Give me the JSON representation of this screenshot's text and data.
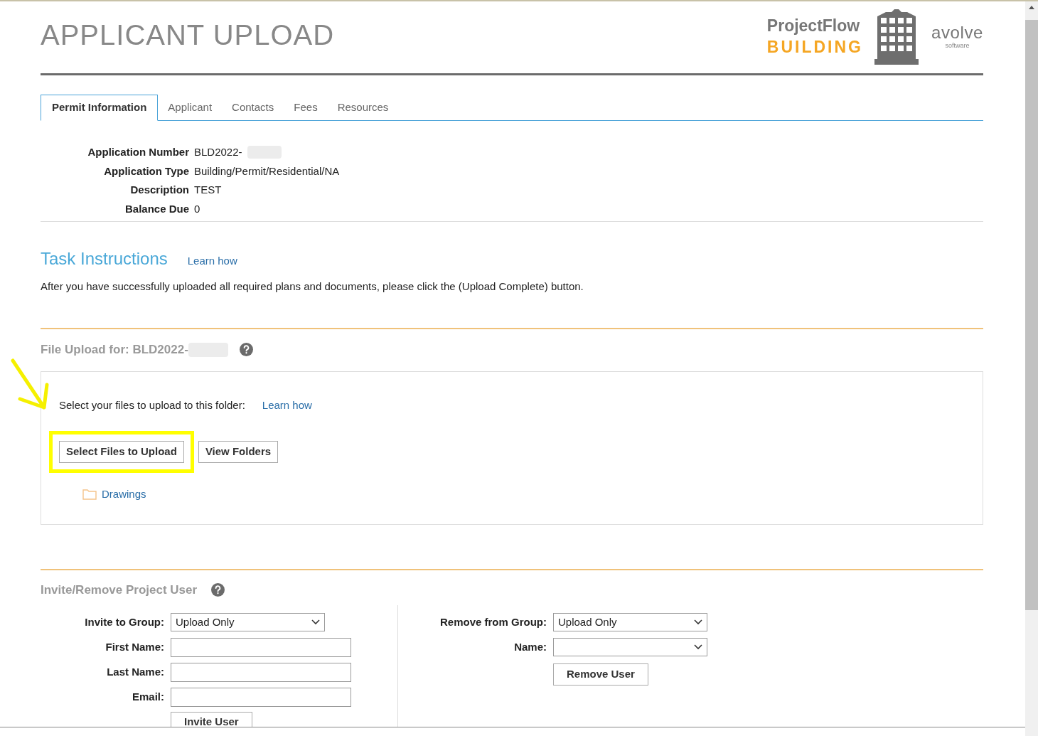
{
  "page_title": "APPLICANT UPLOAD",
  "logo": {
    "line_1": "ProjectFlow",
    "line_2": "BUILDING",
    "vendor": "avolve",
    "vendor_sub": "software"
  },
  "tabs": [
    {
      "label": "Permit Information",
      "selected": true
    },
    {
      "label": "Applicant",
      "selected": false
    },
    {
      "label": "Contacts",
      "selected": false
    },
    {
      "label": "Fees",
      "selected": false
    },
    {
      "label": "Resources",
      "selected": false
    }
  ],
  "details": [
    {
      "label": "Application Number",
      "value": "BLD2022-",
      "redacted": true
    },
    {
      "label": "Application Type",
      "value": "Building/Permit/Residential/NA",
      "redacted": false
    },
    {
      "label": "Description",
      "value": "TEST",
      "redacted": false
    },
    {
      "label": "Balance Due",
      "value": "0",
      "redacted": false
    }
  ],
  "task_instructions": {
    "title": "Task Instructions",
    "link": "Learn how",
    "text": "After you have successfully uploaded all required plans and documents, please click the (Upload Complete) button."
  },
  "file_upload": {
    "title": "File Upload for: BLD2022-",
    "prompt": "Select your files to upload to this folder:",
    "link": "Learn how",
    "buttons": [
      {
        "label": "Select Files to Upload",
        "highlighted": true
      },
      {
        "label": "View Folders",
        "highlighted": false
      }
    ],
    "folders": [
      "Drawings"
    ]
  },
  "invite": {
    "title": "Invite/Remove Project User",
    "left_fields": [
      {
        "label": "Invite to Group:",
        "kind": "select",
        "value": "Upload Only"
      },
      {
        "label": "First Name:",
        "kind": "text"
      },
      {
        "label": "Last Name:",
        "kind": "text"
      },
      {
        "label": "Email:",
        "kind": "text"
      }
    ],
    "left_button": "Invite User",
    "right_fields": [
      {
        "label": "Remove from Group:",
        "kind": "select",
        "value": "Upload Only"
      },
      {
        "label": "Name:",
        "kind": "select"
      }
    ],
    "right_button": "Remove User"
  }
}
